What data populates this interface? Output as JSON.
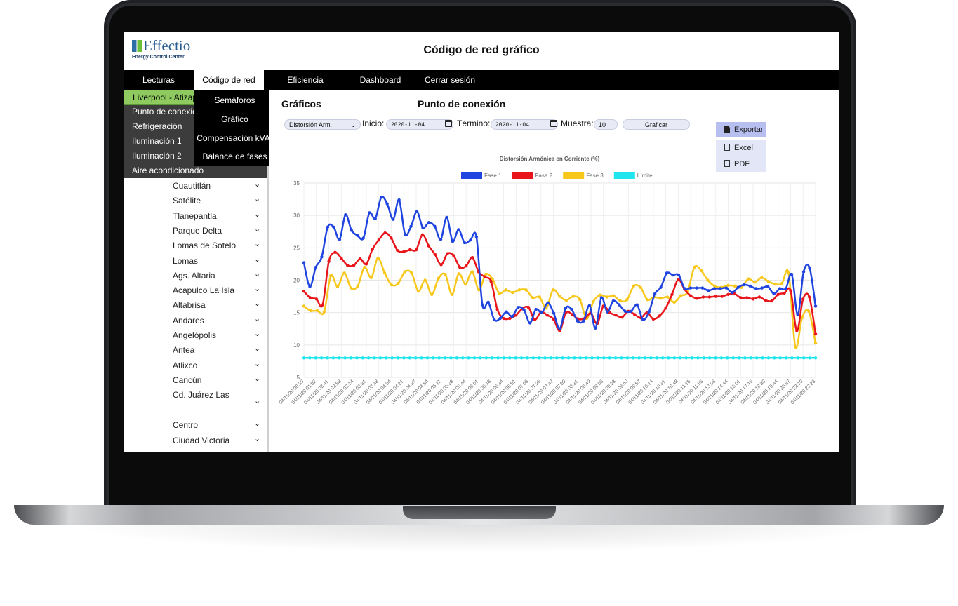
{
  "app": {
    "logo_name": "Effectio",
    "logo_sub": "Energy Control Center",
    "title": "Código de red gráfico"
  },
  "nav": {
    "items": [
      {
        "label": "Lecturas"
      },
      {
        "label": "Código de red"
      },
      {
        "label": "Eficiencia energética"
      },
      {
        "label": "Dashboard"
      },
      {
        "label": "Cerrar sesión"
      }
    ]
  },
  "sidebar": {
    "items": [
      {
        "label": "Liverpool - Atizap"
      },
      {
        "label": "Punto de conexió"
      },
      {
        "label": "Refrigeración"
      },
      {
        "label": "Iluminación 1"
      },
      {
        "label": "Iluminación 2"
      },
      {
        "label": "Aire acondicionado"
      }
    ],
    "locations": [
      "Cuautitlán",
      "Satélite",
      "Tlanepantla",
      "Parque Delta",
      "Lomas de Sotelo",
      "Lomas",
      "Ags. Altaria",
      "Acapulco La Isla",
      "Altabrisa",
      "Andares",
      "Angelópolis",
      "Antea",
      "Atlixco",
      "Cancún",
      "Cd. Juárez Las",
      "Centro",
      "Ciudad Victoria"
    ],
    "chevron_icon": "chevron-down-icon"
  },
  "submenu": {
    "items": [
      {
        "label": "Semáforos"
      },
      {
        "label": "Gráfico"
      },
      {
        "label": "Compensación kVAr"
      },
      {
        "label": "Balance de fases"
      }
    ]
  },
  "main": {
    "heading": "Gráficos",
    "subheading": "Punto de conexión",
    "select_value": "Distorsión Arm.",
    "inicio_label": "Inicio:",
    "inicio_value": "2020-11-04",
    "termino_label": "Término:",
    "termino_value": "2020-11-04",
    "muestra_label": "Muestra:",
    "muestra_value": "10",
    "graficar_label": "Graficar",
    "export_label": "Exportar",
    "excel_label": "Excel",
    "pdf_label": "PDF"
  },
  "chart_data": {
    "type": "line",
    "title": "Distorsión Armónica en Corriente (%)",
    "legend_position": "top",
    "grid": true,
    "ylim": [
      5,
      35
    ],
    "yticks": [
      5,
      10,
      15,
      20,
      25,
      30,
      35
    ],
    "xtick_labels": [
      "04/11/20 00:39",
      "04/11/20 01:52",
      "04/11/20 02:41",
      "04/11/20 02:58",
      "04/11/20 03:14",
      "04/11/20 03:31",
      "04/11/20 03:48",
      "04/11/20 04:04",
      "04/11/20 04:21",
      "04/11/20 04:37",
      "04/11/20 04:54",
      "04/11/20 05:11",
      "04/11/20 05:28",
      "04/11/20 05:44",
      "04/11/20 06:01",
      "04/11/20 06:18",
      "04/11/20 06:34",
      "04/11/20 06:51",
      "04/11/20 07:08",
      "04/11/20 07:25",
      "04/11/20 07:42",
      "04/11/20 07:59",
      "04/11/20 08:31",
      "04/11/20 08:49",
      "04/11/20 09:06",
      "04/11/20 09:23",
      "04/11/20 09:40",
      "04/11/20 09:57",
      "04/11/20 10:14",
      "04/11/20 10:31",
      "04/11/20 10:48",
      "04/11/20 11:15",
      "04/11/20 11:55",
      "04/11/20 13:06",
      "04/11/20 14:44",
      "04/11/20 16:01",
      "04/11/20 17:15",
      "04/11/20 18:30",
      "04/11/20 19:44",
      "04/11/20 20:57",
      "04/11/20 22:10",
      "04/11/20 23:23"
    ],
    "series": [
      {
        "name": "Fase 1",
        "color": "#1f44e0",
        "values": [
          22.7,
          19.0,
          22.0,
          23.6,
          28.2,
          28.2,
          26.3,
          30.1,
          27.7,
          26.9,
          26.5,
          30.4,
          29.5,
          32.8,
          31.8,
          29.4,
          32.4,
          27.1,
          28.3,
          30.6,
          28.1,
          28.9,
          28.3,
          26.3,
          29.7,
          26.0,
          27.8,
          25.8,
          26.2,
          26.7,
          16.2,
          16.6,
          13.9,
          14.1,
          15.1,
          14.4,
          15.8,
          15.4,
          13.4,
          15.5,
          15.0,
          16.5,
          14.9,
          12.5,
          15.7,
          15.5,
          13.7,
          13.7,
          16.1,
          12.6,
          17.3,
          15.1,
          16.8,
          16.2,
          15.2,
          15.2,
          16.2,
          13.9,
          15.1,
          17.9,
          18.9,
          21.1,
          20.8,
          20.8,
          18.7,
          18.8,
          18.8,
          18.8,
          18.4,
          18.7,
          18.7,
          18.8,
          18.1,
          18.9,
          19.3,
          19.1,
          18.7,
          18.8,
          19.0,
          17.9,
          18.7,
          18.7,
          20.9,
          14.7,
          21.3,
          21.9,
          16.0
        ]
      },
      {
        "name": "Fase 2",
        "color": "#e8151b",
        "values": [
          18.3,
          17.3,
          17.1,
          16.2,
          22.9,
          24.3,
          23.4,
          22.3,
          22.3,
          23.3,
          22.5,
          24.8,
          26.2,
          27.3,
          26.5,
          24.6,
          24.4,
          24.7,
          24.7,
          27.0,
          25.3,
          24.0,
          22.4,
          24.1,
          23.8,
          22.0,
          22.2,
          23.5,
          21.3,
          20.5,
          19.8,
          15.5,
          14.1,
          14.1,
          14.6,
          15.6,
          15.8,
          13.9,
          15.1,
          14.6,
          14.0,
          12.2,
          15.0,
          14.7,
          14.0,
          14.1,
          14.9,
          13.3,
          16.0,
          15.0,
          14.6,
          14.3,
          15.2,
          14.7,
          14.2,
          15.0,
          14.0,
          14.5,
          15.7,
          17.8,
          20.1,
          18.6,
          17.6,
          17.2,
          17.4,
          17.4,
          17.5,
          17.5,
          17.8,
          17.9,
          17.3,
          17.3,
          17.1,
          17.4,
          16.9,
          16.8,
          17.8,
          18.0,
          18.4,
          12.2,
          17.1,
          17.4,
          11.7
        ]
      },
      {
        "name": "Fase 3",
        "color": "#f7c81b",
        "values": [
          16.0,
          15.3,
          15.3,
          15.1,
          20.7,
          19.0,
          21.1,
          18.8,
          19.1,
          22.0,
          20.4,
          23.4,
          21.1,
          19.3,
          19.5,
          21.3,
          21.1,
          18.3,
          20.0,
          17.8,
          20.3,
          20.9,
          17.8,
          21.0,
          19.4,
          21.3,
          18.5,
          20.9,
          20.2,
          18.0,
          18.5,
          18.1,
          18.5,
          18.5,
          17.3,
          17.4,
          15.7,
          18.5,
          17.5,
          16.9,
          17.5,
          17.0,
          14.1,
          16.7,
          17.7,
          17.4,
          17.6,
          16.8,
          17.0,
          19.1,
          18.9,
          17.0,
          17.4,
          17.2,
          17.4,
          16.6,
          17.6,
          18.2,
          22.0,
          21.5,
          20.0,
          19.1,
          18.9,
          19.2,
          19.1,
          18.9,
          20.2,
          19.7,
          20.4,
          19.8,
          19.4,
          19.5,
          21.1,
          9.7,
          14.2,
          15.2,
          10.3
        ]
      },
      {
        "name": "Límite",
        "color": "#1fe6ee",
        "values": [
          8,
          8,
          8,
          8,
          8,
          8,
          8,
          8,
          8,
          8,
          8,
          8,
          8,
          8,
          8,
          8,
          8,
          8,
          8,
          8,
          8,
          8,
          8,
          8,
          8,
          8,
          8,
          8,
          8,
          8,
          8,
          8,
          8,
          8,
          8,
          8,
          8,
          8,
          8,
          8,
          8,
          8,
          8,
          8,
          8,
          8,
          8,
          8,
          8,
          8,
          8,
          8,
          8,
          8,
          8,
          8,
          8,
          8,
          8,
          8,
          8,
          8,
          8,
          8,
          8,
          8,
          8,
          8,
          8,
          8,
          8,
          8,
          8,
          8,
          8,
          8,
          8,
          8,
          8,
          8,
          8,
          8,
          8,
          8,
          8,
          8,
          8,
          8
        ]
      }
    ]
  }
}
